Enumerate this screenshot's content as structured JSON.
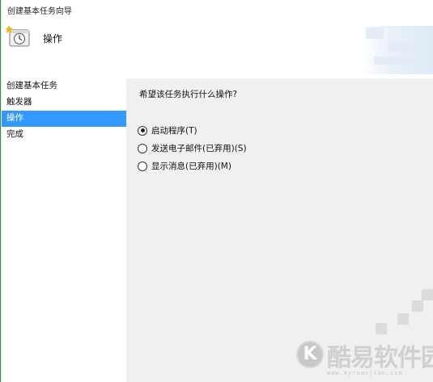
{
  "window": {
    "title": "创建基本任务向导"
  },
  "header": {
    "icon": "task-scheduler-clock-icon",
    "title": "操作"
  },
  "sidebar": {
    "items": [
      {
        "label": "创建基本任务",
        "active": false
      },
      {
        "label": "触发器",
        "active": false
      },
      {
        "label": "操作",
        "active": true
      },
      {
        "label": "完成",
        "active": false
      }
    ]
  },
  "main": {
    "question": "希望该任务执行什么操作?",
    "options": [
      {
        "label": "启动程序(T)",
        "checked": true
      },
      {
        "label": "发送电子邮件(已弃用)(S)",
        "checked": false
      },
      {
        "label": "显示消息(已弃用)(M)",
        "checked": false
      }
    ]
  },
  "watermark": {
    "logo_letter": "K",
    "text": "酷易软件园",
    "url": "www.kyruanjian.com"
  },
  "colors": {
    "selection": "#3399ff",
    "frame_border": "#2e8b4a",
    "panel_bg": "#f0f0f0",
    "header_bg": "#ffffff"
  }
}
